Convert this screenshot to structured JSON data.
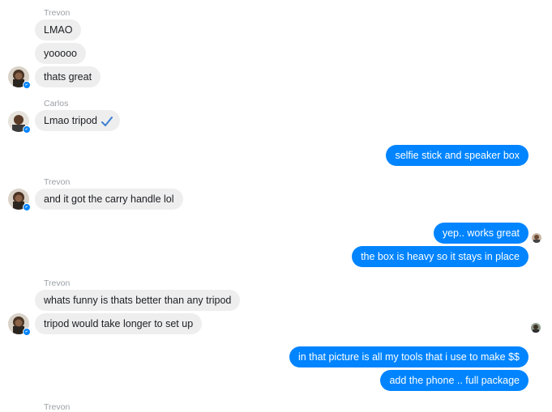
{
  "chat": {
    "groups": [
      {
        "sender": "Trevon",
        "messages": [
          "LMAO",
          "yooooo",
          "thats great"
        ]
      },
      {
        "sender": "Carlos",
        "messages": [
          "Lmao tripod"
        ]
      },
      {
        "sender": "me",
        "messages": [
          "selfie stick and speaker box"
        ]
      },
      {
        "sender": "Trevon",
        "messages": [
          "and it got the carry handle lol"
        ]
      },
      {
        "sender": "me",
        "messages": [
          "yep.. works great",
          "the box is heavy so it stays in place"
        ]
      },
      {
        "sender": "Trevon",
        "messages": [
          "whats funny is thats better than any tripod",
          "tripod would take longer to set up"
        ]
      },
      {
        "sender": "me",
        "messages": [
          "in that picture is all my tools that i use to make $$",
          "add the phone .. full package"
        ]
      },
      {
        "sender": "Trevon",
        "messages": []
      }
    ]
  },
  "colors": {
    "outgoing_bubble": "#0084ff",
    "incoming_bubble": "#eeeeef",
    "sender_label": "#9aa0a6"
  },
  "icons": {
    "messenger_badge": "messenger-badge-icon",
    "sent_check": "check-icon",
    "read_receipt": "read-receipt-avatar"
  }
}
